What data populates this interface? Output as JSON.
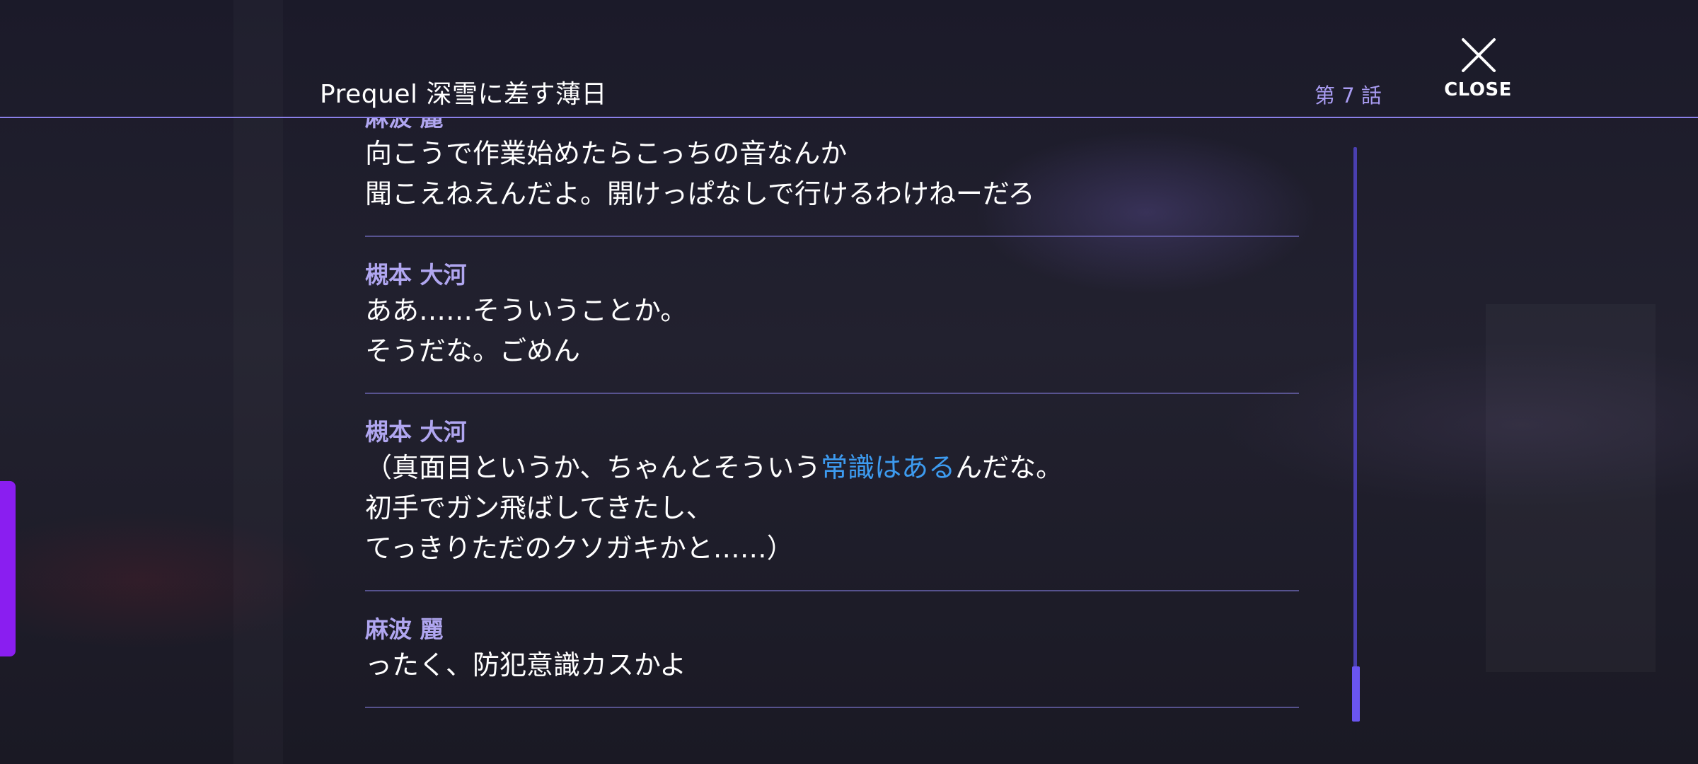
{
  "header": {
    "story_title": "Prequel 深雪に差す薄日",
    "episode": "第 7 話",
    "close_label": "CLOSE"
  },
  "log": {
    "entries": [
      {
        "speaker": "麻波 麗",
        "lines": [
          "向こうで作業始めたらこっちの音なんか",
          "聞こえねえんだよ。開けっぱなしで行けるわけねーだろ"
        ]
      },
      {
        "speaker": "槻本 大河",
        "lines": [
          "ああ……そういうことか。",
          "そうだな。ごめん"
        ]
      },
      {
        "speaker": "槻本 大河",
        "line1_pre": "（真面目というか、ちゃんとそういう",
        "line1_highlight": "常識はある",
        "line1_post": "んだな。",
        "lines_rest": [
          "初手でガン飛ばしてきたし、",
          "てっきりただのクソガキかと……）"
        ]
      },
      {
        "speaker": "麻波 麗",
        "lines": [
          "ったく、防犯意識カスかよ"
        ]
      }
    ]
  },
  "colors": {
    "accent": "#8a7fe8",
    "speaker": "#b0a6f0",
    "highlight": "#3d9bf0",
    "side_tab": "#8a1ef0",
    "scroll_thumb": "#6a55f0"
  },
  "icons": {
    "close": "close-icon"
  }
}
